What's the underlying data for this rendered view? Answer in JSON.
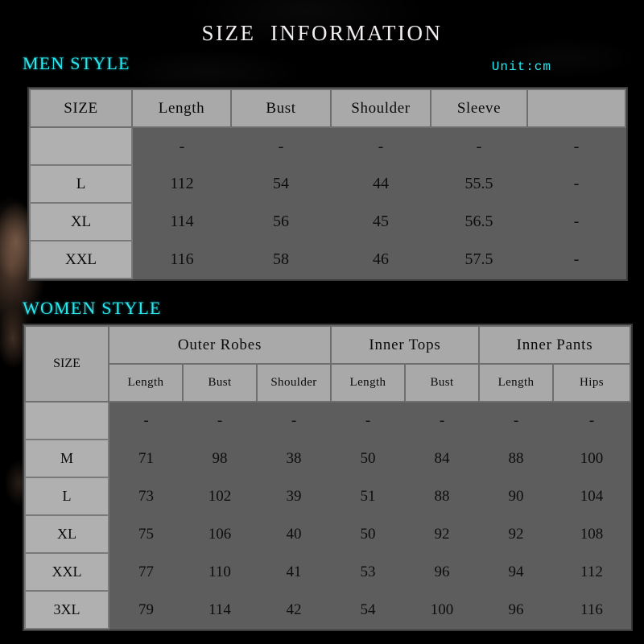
{
  "page": {
    "title": "SIZE  INFORMATION",
    "unit": "Unit:cm",
    "accent_color": "#28e8f0",
    "title_color": "#f2eef0",
    "header_cell_color": "#a9a9a9",
    "body_cell_color": "#5d5d5d",
    "dash": "-"
  },
  "men": {
    "label": "MEN STYLE",
    "columns": [
      "SIZE",
      "Length",
      "Bust",
      "Shoulder",
      "Sleeve",
      ""
    ],
    "rows": [
      {
        "size": "",
        "values": [
          "-",
          "-",
          "-",
          "-",
          "-"
        ]
      },
      {
        "size": "L",
        "values": [
          "112",
          "54",
          "44",
          "55.5",
          "-"
        ]
      },
      {
        "size": "XL",
        "values": [
          "114",
          "56",
          "45",
          "56.5",
          "-"
        ]
      },
      {
        "size": "XXL",
        "values": [
          "116",
          "58",
          "46",
          "57.5",
          "-"
        ]
      }
    ]
  },
  "women": {
    "label": "WOMEN STYLE",
    "groups": [
      {
        "label": "",
        "span": 1
      },
      {
        "label": "Outer Robes",
        "span": 3
      },
      {
        "label": "Inner Tops",
        "span": 2
      },
      {
        "label": "Inner Pants",
        "span": 2
      }
    ],
    "columns": [
      "SIZE",
      "Length",
      "Bust",
      "Shoulder",
      "Length",
      "Bust",
      "Length",
      "Hips"
    ],
    "rows": [
      {
        "size": "",
        "values": [
          "-",
          "-",
          "-",
          "-",
          "-",
          "-",
          "-"
        ]
      },
      {
        "size": "M",
        "values": [
          "71",
          "98",
          "38",
          "50",
          "84",
          "88",
          "100"
        ]
      },
      {
        "size": "L",
        "values": [
          "73",
          "102",
          "39",
          "51",
          "88",
          "90",
          "104"
        ]
      },
      {
        "size": "XL",
        "values": [
          "75",
          "106",
          "40",
          "50",
          "92",
          "92",
          "108"
        ]
      },
      {
        "size": "XXL",
        "values": [
          "77",
          "110",
          "41",
          "53",
          "96",
          "94",
          "112"
        ]
      },
      {
        "size": "3XL",
        "values": [
          "79",
          "114",
          "42",
          "54",
          "100",
          "96",
          "116"
        ]
      }
    ]
  }
}
